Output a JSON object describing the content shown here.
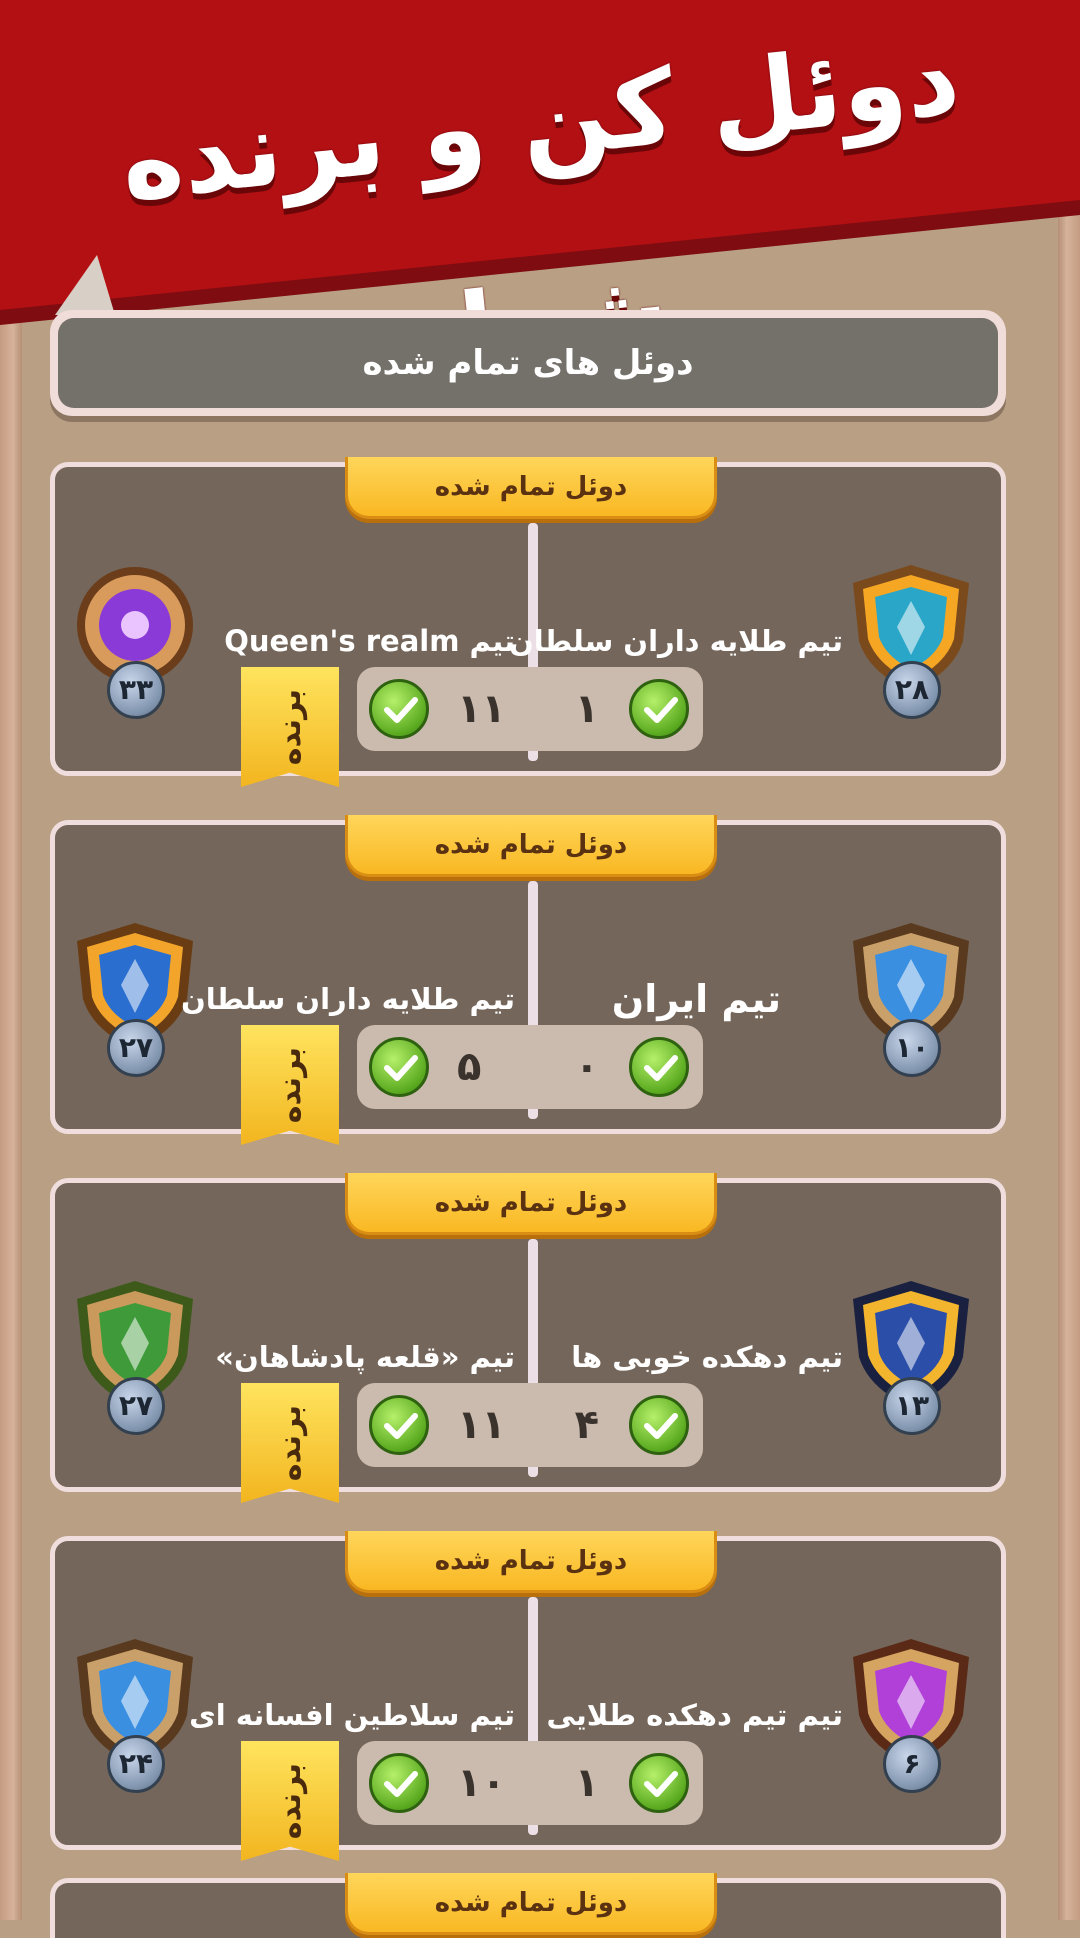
{
  "banner": {
    "title": "دوئل کن و برنده شو!"
  },
  "header": {
    "title": "دوئل های تمام شده"
  },
  "duels": [
    {
      "status": "دوئل تمام شده",
      "right_team": {
        "name": "تیم طلایه داران سلطان",
        "rank": "۲۸",
        "score": "۱",
        "emblem": "gold-wings-emblem"
      },
      "left_team": {
        "name": "تیم Queen's realm",
        "rank": "۳۳",
        "score": "۱۱",
        "emblem": "purple-orb-emblem"
      },
      "winner_label": "برنده"
    },
    {
      "status": "دوئل تمام شده",
      "right_team": {
        "name": "تیم ایران",
        "rank": "۱۰",
        "score": "۰",
        "emblem": "blue-shield-emblem"
      },
      "left_team": {
        "name": "تیم طلایه داران سلطان",
        "rank": "۲۷",
        "score": "۵",
        "emblem": "crystal-shield-emblem"
      },
      "winner_label": "برنده"
    },
    {
      "status": "دوئل تمام شده",
      "right_team": {
        "name": "تیم دهکده خوبی ها",
        "rank": "۱۳",
        "score": "۴",
        "emblem": "winged-gem-emblem"
      },
      "left_team": {
        "name": "تیم «قلعه پادشاهان»",
        "rank": "۲۷",
        "score": "۱۱",
        "emblem": "green-leaf-shield-emblem"
      },
      "winner_label": "برنده"
    },
    {
      "status": "دوئل تمام شده",
      "right_team": {
        "name": "تیم تیم دهکده طلایی",
        "rank": "۶",
        "score": "۱",
        "emblem": "purple-gem-shield-emblem"
      },
      "left_team": {
        "name": "تیم سلاطین افسانه ای",
        "rank": "۲۴",
        "score": "۱۰",
        "emblem": "blue-shield-emblem"
      },
      "winner_label": "برنده"
    }
  ],
  "partial_duel": {
    "status": "دوئل تمام شده"
  },
  "colors": {
    "banner_red": "#b31014",
    "card_bg": "#74665a",
    "tag_gold": "#f9b823",
    "check_green": "#5aaa20"
  }
}
